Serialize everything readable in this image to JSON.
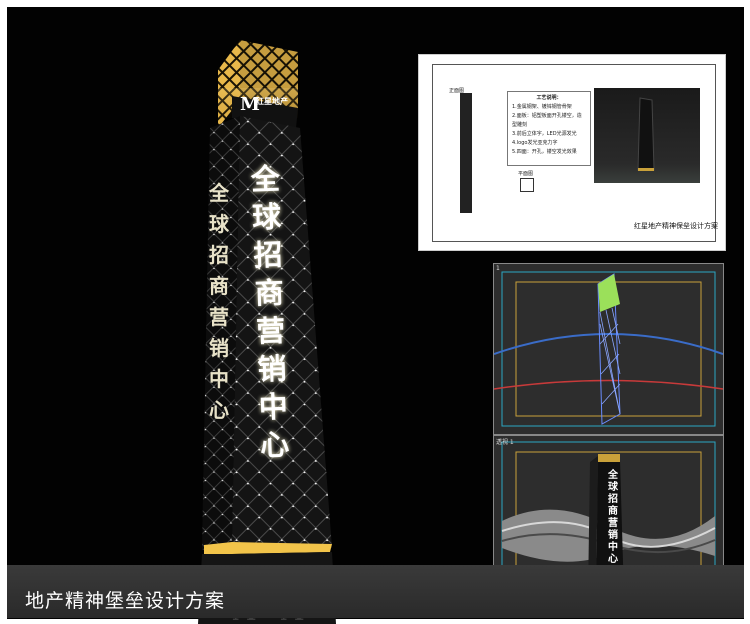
{
  "caption": "地产精神堡垒设计方案",
  "tower": {
    "main_text": "全球招商营销中心",
    "side_text": "全球招商营销中心",
    "logo_letter": "M",
    "logo_text": "红星地产"
  },
  "drawing_sheet": {
    "title": "工艺说明：",
    "notes": [
      "1.金属钢架、镀锌钢管骨架",
      "2.面板：铝塑板面开孔镂空，造型雕刻",
      "3.前后立体字，LED光源发光",
      "4.logo发光亚克力字",
      "5.四面：开孔，镂空发光效果"
    ],
    "elevation_label": "正面图",
    "plan_label": "平面图",
    "caption": "红星地产精神保垒设计方案"
  },
  "viewports": {
    "top_label": "1",
    "bottom_label": "透视 1",
    "bottom_text": "全球招商营销中心"
  },
  "colors": {
    "background": "#020202",
    "tower_glow": "#f2c44a",
    "caption_bar": "#333333"
  }
}
